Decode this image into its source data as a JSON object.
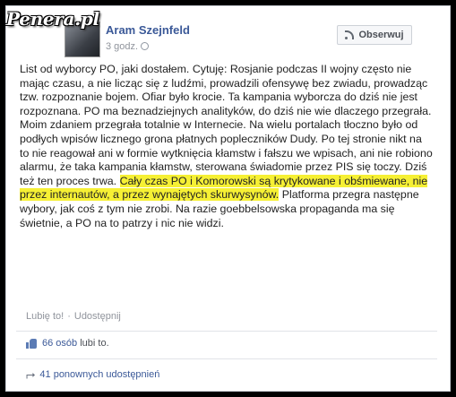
{
  "watermark": "Penera.pl",
  "post": {
    "author": "Aram Szejnfeld",
    "time": "3 godz.",
    "follow_label": "Obserwuj",
    "text_before": "List od wyborcy PO, jaki dostałem. Cytuję: Rosjanie podczas II wojny często nie mając czasu, a nie licząc się z ludźmi, prowadzili ofensywę bez zwiadu, prowadząc tzw. rozpoznanie bojem. Ofiar było krocie. Ta kampania wyborcza do dziś nie jest rozpoznana. PO ma beznadziejnych analityków, do dziś nie wie dlaczego przegrała. Moim zdaniem przegrała totalnie w Internecie. Na wielu portalach tłoczno było od podłych wpisów licznego grona płatnych popleczników Dudy. Po tej stronie nikt na to nie reagował ani w formie wytknięcia kłamstw i fałszu we wpisach, ani nie robiono alarmu, że taka kampania kłamstw, sterowana świadomie przez PIS się toczy. Dziś też ten proces trwa. ",
    "text_highlight": "Cały czas PO i Komorowski są krytykowane i obśmiewane, nie przez internautów, a przez wynajętych skurwysynów.",
    "text_after": " Platforma przegra następne wybory, jak coś z tym nie zrobi. Na razie goebbelsowska propaganda ma się świetnie, a PO na to patrzy i nic nie widzi.",
    "like_label": "Lubię to!",
    "separator": "·",
    "share_label": "Udostępnij",
    "likes_count": "66 osób",
    "likes_suffix": "lubi to.",
    "shares_label": "41 ponownych udostępnień"
  }
}
